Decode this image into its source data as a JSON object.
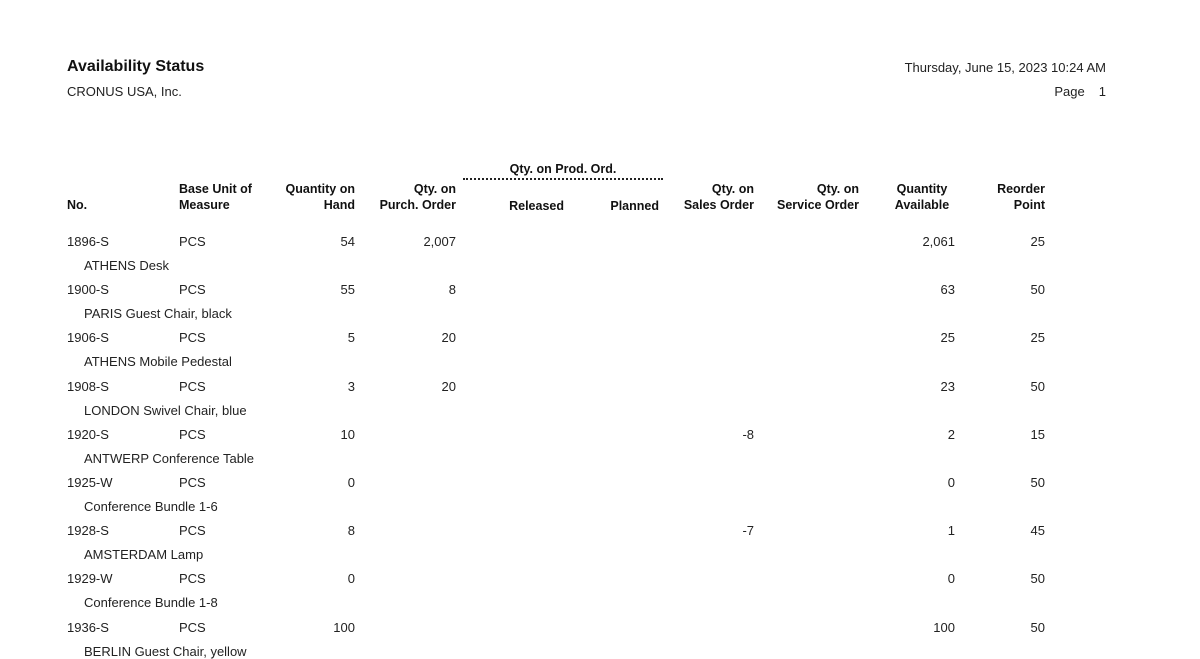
{
  "report": {
    "title": "Availability Status",
    "company": "CRONUS USA, Inc.",
    "datetime": "Thursday, June 15, 2023 10:24 AM",
    "page_label": "Page",
    "page_number": "1"
  },
  "columns": {
    "no": "No.",
    "base_unit_l1": "Base Unit of",
    "base_unit_l2": "Measure",
    "qty_hand_l1": "Quantity on",
    "qty_hand_l2": "Hand",
    "qty_purch_l1": "Qty. on",
    "qty_purch_l2": "Purch. Order",
    "prod_group": "Qty. on Prod. Ord.",
    "released": "Released",
    "planned": "Planned",
    "qty_sales_l1": "Qty. on",
    "qty_sales_l2": "Sales Order",
    "qty_service_l1": "Qty. on",
    "qty_service_l2": "Service Order",
    "qty_avail_l1": "Quantity",
    "qty_avail_l2": "Available",
    "reorder_l1": "Reorder",
    "reorder_l2": "Point"
  },
  "rows": [
    {
      "no": "1896-S",
      "uom": "PCS",
      "on_hand": "54",
      "purch": "2,007",
      "released": "",
      "planned": "",
      "sales": "",
      "service": "",
      "available": "2,061",
      "reorder": "25",
      "description": "ATHENS Desk"
    },
    {
      "no": "1900-S",
      "uom": "PCS",
      "on_hand": "55",
      "purch": "8",
      "released": "",
      "planned": "",
      "sales": "",
      "service": "",
      "available": "63",
      "reorder": "50",
      "description": "PARIS Guest Chair, black"
    },
    {
      "no": "1906-S",
      "uom": "PCS",
      "on_hand": "5",
      "purch": "20",
      "released": "",
      "planned": "",
      "sales": "",
      "service": "",
      "available": "25",
      "reorder": "25",
      "description": "ATHENS Mobile Pedestal"
    },
    {
      "no": "1908-S",
      "uom": "PCS",
      "on_hand": "3",
      "purch": "20",
      "released": "",
      "planned": "",
      "sales": "",
      "service": "",
      "available": "23",
      "reorder": "50",
      "description": "LONDON Swivel Chair, blue"
    },
    {
      "no": "1920-S",
      "uom": "PCS",
      "on_hand": "10",
      "purch": "",
      "released": "",
      "planned": "",
      "sales": "-8",
      "service": "",
      "available": "2",
      "reorder": "15",
      "description": "ANTWERP Conference Table"
    },
    {
      "no": "1925-W",
      "uom": "PCS",
      "on_hand": "0",
      "purch": "",
      "released": "",
      "planned": "",
      "sales": "",
      "service": "",
      "available": "0",
      "reorder": "50",
      "description": "Conference Bundle 1-6"
    },
    {
      "no": "1928-S",
      "uom": "PCS",
      "on_hand": "8",
      "purch": "",
      "released": "",
      "planned": "",
      "sales": "-7",
      "service": "",
      "available": "1",
      "reorder": "45",
      "description": "AMSTERDAM Lamp"
    },
    {
      "no": "1929-W",
      "uom": "PCS",
      "on_hand": "0",
      "purch": "",
      "released": "",
      "planned": "",
      "sales": "",
      "service": "",
      "available": "0",
      "reorder": "50",
      "description": "Conference Bundle 1-8"
    },
    {
      "no": "1936-S",
      "uom": "PCS",
      "on_hand": "100",
      "purch": "",
      "released": "",
      "planned": "",
      "sales": "",
      "service": "",
      "available": "100",
      "reorder": "50",
      "description": "BERLIN Guest Chair, yellow"
    }
  ]
}
